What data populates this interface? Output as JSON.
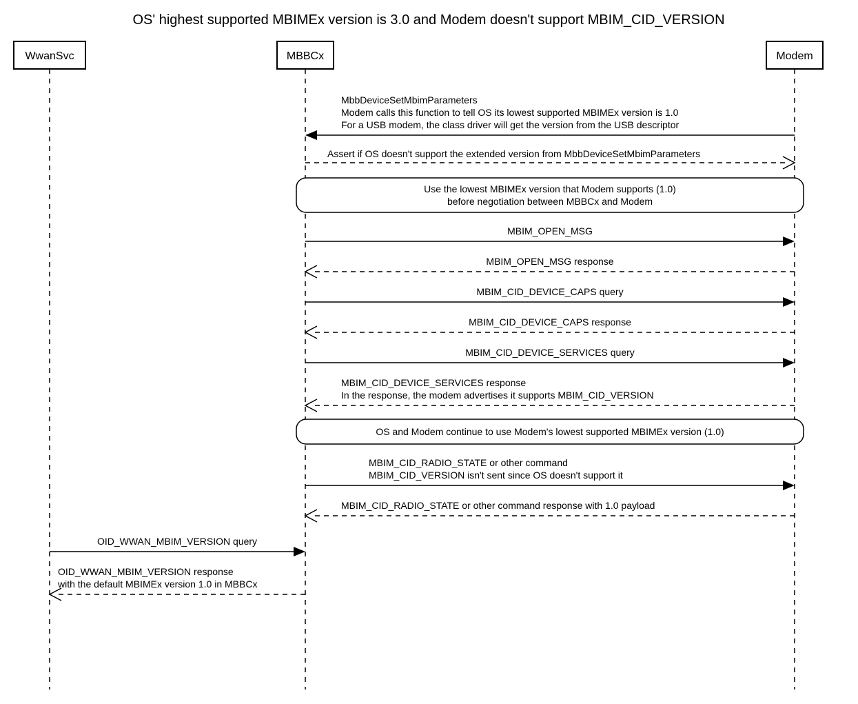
{
  "title": "OS' highest supported MBIMEx version is 3.0 and Modem doesn't support MBIM_CID_VERSION",
  "actors": {
    "wwansvc": "WwanSvc",
    "mbbcx": "MBBCx",
    "modem": "Modem"
  },
  "messages": {
    "m1l1": "MbbDeviceSetMbimParameters",
    "m1l2": "Modem calls this function to tell OS its lowest supported MBIMEx version is 1.0",
    "m1l3": "For a USB modem, the class driver will get the version from the USB descriptor",
    "m2": "Assert if OS doesn't support the extended version from MbbDeviceSetMbimParameters",
    "note1l1": "Use the lowest MBIMEx version that Modem supports (1.0)",
    "note1l2": "before negotiation between MBBCx and Modem",
    "m3": "MBIM_OPEN_MSG",
    "m4": "MBIM_OPEN_MSG response",
    "m5": "MBIM_CID_DEVICE_CAPS query",
    "m6": "MBIM_CID_DEVICE_CAPS response",
    "m7": "MBIM_CID_DEVICE_SERVICES query",
    "m8l1": "MBIM_CID_DEVICE_SERVICES response",
    "m8l2": "In the response, the modem advertises it supports MBIM_CID_VERSION",
    "note2": "OS and Modem continue to use Modem's lowest supported MBIMEx version (1.0)",
    "m9l1": "MBIM_CID_RADIO_STATE or other command",
    "m9l2": "MBIM_CID_VERSION isn't sent since OS doesn't support it",
    "m10": "MBIM_CID_RADIO_STATE or other command response with 1.0 payload",
    "m11": "OID_WWAN_MBIM_VERSION query",
    "m12l1": "OID_WWAN_MBIM_VERSION response",
    "m12l2": "with the default MBIMEx version 1.0 in MBBCx"
  },
  "chart_data": {
    "type": "sequence_diagram",
    "title": "OS' highest supported MBIMEx version is 3.0 and Modem doesn't support MBIM_CID_VERSION",
    "actors": [
      "WwanSvc",
      "MBBCx",
      "Modem"
    ],
    "steps": [
      {
        "from": "Modem",
        "to": "MBBCx",
        "style": "solid",
        "text": "MbbDeviceSetMbimParameters — Modem calls this function to tell OS its lowest supported MBIMEx version is 1.0. For a USB modem, the class driver will get the version from the USB descriptor"
      },
      {
        "from": "MBBCx",
        "to": "Modem",
        "style": "dashed",
        "text": "Assert if OS doesn't support the extended version from MbbDeviceSetMbimParameters"
      },
      {
        "note_over": [
          "MBBCx",
          "Modem"
        ],
        "text": "Use the lowest MBIMEx version that Modem supports (1.0) before negotiation between MBBCx and Modem"
      },
      {
        "from": "MBBCx",
        "to": "Modem",
        "style": "solid",
        "text": "MBIM_OPEN_MSG"
      },
      {
        "from": "Modem",
        "to": "MBBCx",
        "style": "dashed",
        "text": "MBIM_OPEN_MSG response"
      },
      {
        "from": "MBBCx",
        "to": "Modem",
        "style": "solid",
        "text": "MBIM_CID_DEVICE_CAPS query"
      },
      {
        "from": "Modem",
        "to": "MBBCx",
        "style": "dashed",
        "text": "MBIM_CID_DEVICE_CAPS response"
      },
      {
        "from": "MBBCx",
        "to": "Modem",
        "style": "solid",
        "text": "MBIM_CID_DEVICE_SERVICES query"
      },
      {
        "from": "Modem",
        "to": "MBBCx",
        "style": "dashed",
        "text": "MBIM_CID_DEVICE_SERVICES response — In the response, the modem advertises it supports MBIM_CID_VERSION"
      },
      {
        "note_over": [
          "MBBCx",
          "Modem"
        ],
        "text": "OS and Modem continue to use Modem's lowest supported MBIMEx version (1.0)"
      },
      {
        "from": "MBBCx",
        "to": "Modem",
        "style": "solid",
        "text": "MBIM_CID_RADIO_STATE or other command — MBIM_CID_VERSION isn't sent since OS doesn't support it"
      },
      {
        "from": "Modem",
        "to": "MBBCx",
        "style": "dashed",
        "text": "MBIM_CID_RADIO_STATE or other command response with 1.0 payload"
      },
      {
        "from": "WwanSvc",
        "to": "MBBCx",
        "style": "solid",
        "text": "OID_WWAN_MBIM_VERSION query"
      },
      {
        "from": "MBBCx",
        "to": "WwanSvc",
        "style": "dashed",
        "text": "OID_WWAN_MBIM_VERSION response with the default MBIMEx version 1.0 in MBBCx"
      }
    ]
  }
}
